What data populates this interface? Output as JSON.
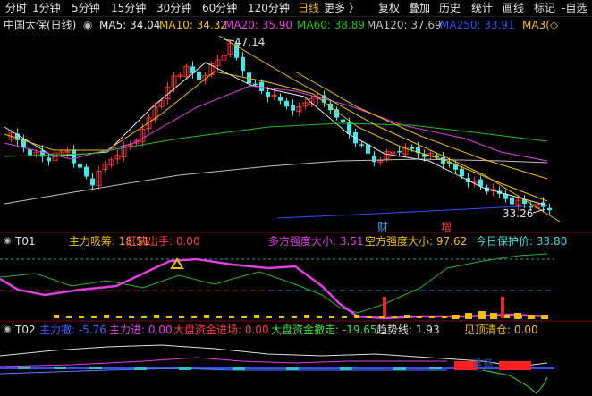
{
  "toolbar": {
    "left": [
      "分时",
      "1分钟",
      "5分钟",
      "15分钟",
      "30分钟",
      "60分钟",
      "120分钟",
      "日线",
      "更多 〉"
    ],
    "active": "日线",
    "right": [
      "复权",
      "叠加",
      "历史",
      "统计",
      "画线",
      "标记",
      "-自选"
    ]
  },
  "main": {
    "title": "中国太保(日线)",
    "ma": [
      {
        "label": "MA5: 34.04",
        "color": "#e8e8e8"
      },
      {
        "label": "MA10: 34.32",
        "color": "#f0c000"
      },
      {
        "label": "MA20: 35.90",
        "color": "#e040e0"
      },
      {
        "label": "MA60: 38.89",
        "color": "#20c020"
      },
      {
        "label": "MA120: 37.69",
        "color": "#c0c0c0"
      },
      {
        "label": "MA250: 33.91",
        "color": "#3050ff"
      },
      {
        "label": "MA3(◇",
        "color": "#f0c000"
      }
    ],
    "high_label": "47.14",
    "low_label": "33.26",
    "marker_cai": "财",
    "marker_zeng": "增"
  },
  "t01": {
    "name": "T01",
    "items": [
      {
        "label": "主力吸筹: 18.51",
        "color": "#f0c000"
      },
      {
        "label": "赶快出手: 0.00",
        "color": "#ff4040"
      },
      {
        "label": "多方强度大小: 3.51",
        "color": "#e040e0"
      },
      {
        "label": "空方强度大小: 97.62",
        "color": "#f0c000"
      },
      {
        "label": "今日保护价: 33.80",
        "color": "#40e0e0"
      }
    ]
  },
  "t02": {
    "name": "T02",
    "items": [
      {
        "label": "主力撤: -5.76",
        "color": "#4060ff"
      },
      {
        "label": "主力进: 0.00",
        "color": "#e040e0"
      },
      {
        "label": "大盘资金进场: 0.00",
        "color": "#ff4040"
      },
      {
        "label": "大盘资金撤走: -19.65",
        "color": "#40e040"
      },
      {
        "label": "趋势线: 1.93",
        "color": "#e0e0e0"
      },
      {
        "label": "见顶清仓: 0.00",
        "color": "#f0c000"
      }
    ],
    "watermark": "准备"
  },
  "colors": {
    "up": "#ff3030",
    "down": "#40e8e8",
    "ma5": "#e8e8e8",
    "ma10": "#f0c000",
    "ma20": "#e040e0",
    "ma60": "#20c020",
    "ma120": "#c0c0c0",
    "ma250": "#3050ff"
  }
}
